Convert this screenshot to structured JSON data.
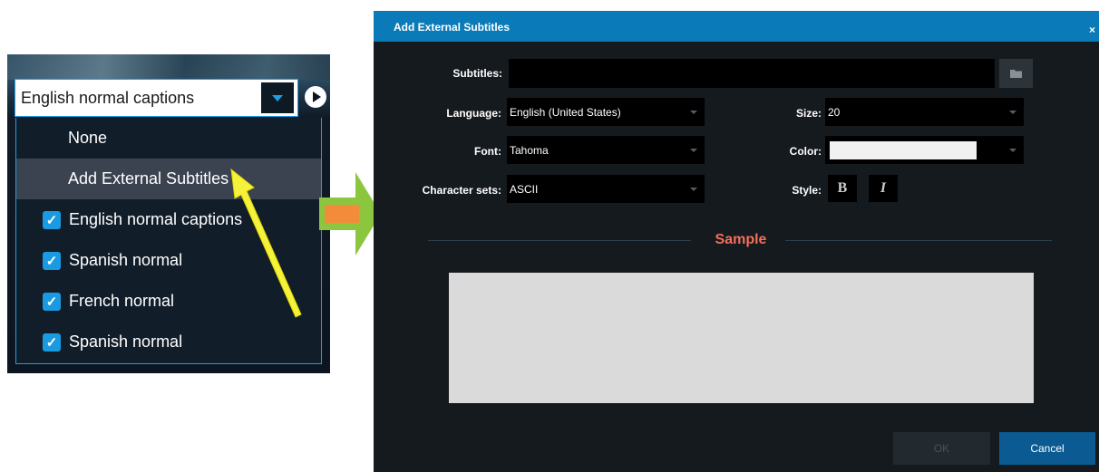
{
  "caption_menu": {
    "selected_value": "English normal captions",
    "items": [
      {
        "label": "None",
        "checked": false
      },
      {
        "label": "Add External Subtitles",
        "checked": false,
        "highlighted": true
      },
      {
        "label": "English normal captions",
        "checked": true
      },
      {
        "label": "Spanish normal",
        "checked": true
      },
      {
        "label": "French normal",
        "checked": true
      },
      {
        "label": "Spanish normal",
        "checked": true
      }
    ]
  },
  "dialog": {
    "title": "Add External Subtitles",
    "close_glyph": "×",
    "subtitles_label": "Subtitles:",
    "subtitles_value": "",
    "language_label": "Language:",
    "language_value": "English (United States)",
    "font_label": "Font:",
    "font_value": "Tahoma",
    "charset_label": "Character sets:",
    "charset_value": "ASCII",
    "size_label": "Size:",
    "size_value": "20",
    "color_label": "Color:",
    "color_value": "#f1f1f1",
    "style_label": "Style:",
    "bold_glyph": "B",
    "italic_glyph": "I",
    "sample_label": "Sample",
    "ok_label": "OK",
    "cancel_label": "Cancel"
  },
  "colors": {
    "accent": "#0b7ab8",
    "checkbox": "#1a9ae0",
    "sample_heading": "#f2705a",
    "dialog_bg": "#151a1f"
  }
}
